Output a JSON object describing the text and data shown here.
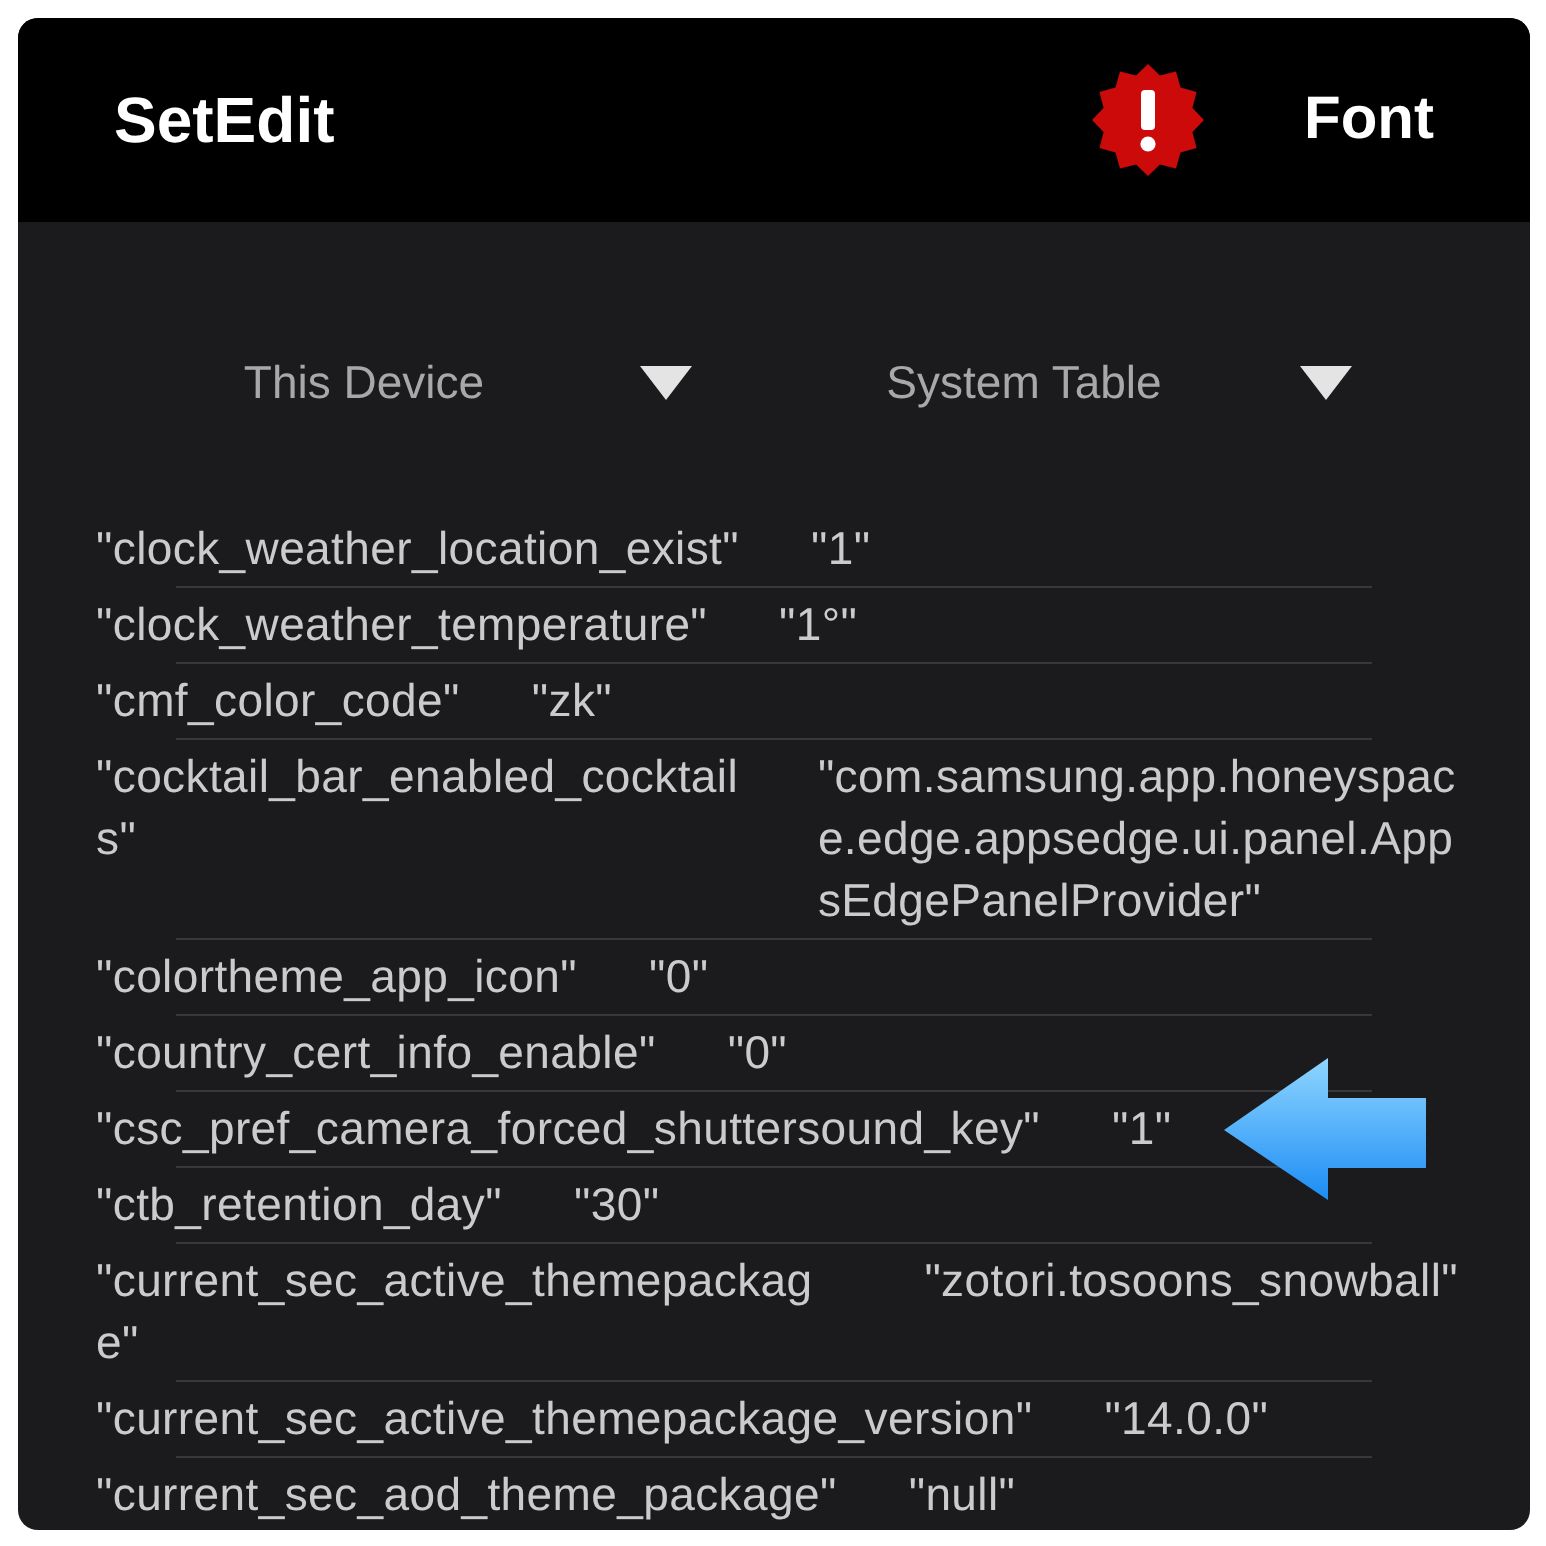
{
  "app_bar": {
    "title": "SetEdit",
    "action": "Font"
  },
  "selectors": [
    {
      "value": "This Device"
    },
    {
      "value": "System Table"
    }
  ],
  "settings": [
    {
      "key": "\"clock_weather_location_exist\"",
      "value": "\"1\"",
      "marked": false
    },
    {
      "key": "\"clock_weather_temperature\"",
      "value": "\"1°\"",
      "marked": false
    },
    {
      "key": "\"cmf_color_code\"",
      "value": "\"zk\"",
      "marked": false
    },
    {
      "key": "\"cocktail_bar_enabled_cocktails\"",
      "value": "\"com.samsung.app.honeyspace.edge.appsedge.ui.panel.AppsEdgePanelProvider\"",
      "marked": false
    },
    {
      "key": "\"colortheme_app_icon\"",
      "value": "\"0\"",
      "marked": false
    },
    {
      "key": "\"country_cert_info_enable\"",
      "value": "\"0\"",
      "marked": false
    },
    {
      "key": "\"csc_pref_camera_forced_shuttersound_key\"",
      "value": "\"1\"",
      "marked": true
    },
    {
      "key": "\"ctb_retention_day\"",
      "value": "\"30\"",
      "marked": false
    },
    {
      "key": "\"current_sec_active_themepackage\"",
      "value": "\"zotori.tosoons_snowball\"",
      "marked": false
    },
    {
      "key": "\"current_sec_active_themepackage_version\"",
      "value": "\"14.0.0\"",
      "marked": false
    },
    {
      "key": "\"current_sec_aod_theme_package\"",
      "value": "\"null\"",
      "marked": false
    }
  ]
}
